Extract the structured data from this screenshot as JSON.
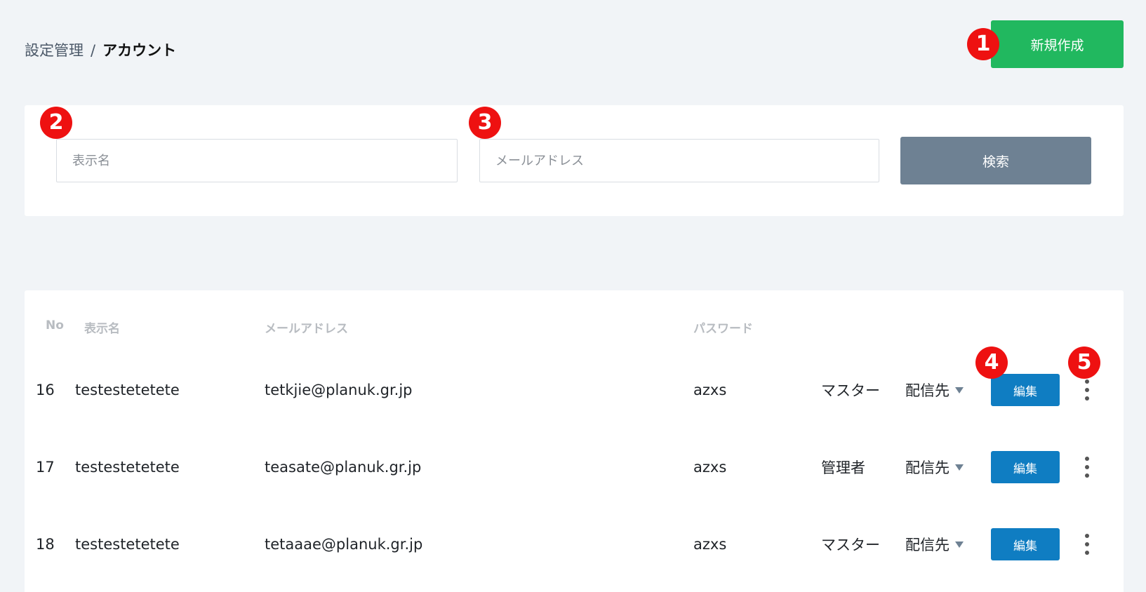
{
  "breadcrumb": {
    "parent": "設定管理",
    "separator": "/",
    "current": "アカウント"
  },
  "header": {
    "new_button": "新規作成"
  },
  "markers": [
    "1",
    "2",
    "3",
    "4",
    "5"
  ],
  "search": {
    "name_placeholder": "表示名",
    "email_placeholder": "メールアドレス",
    "search_button": "検索"
  },
  "table": {
    "headers": {
      "no": "No",
      "name": "表示名",
      "email": "メールアドレス",
      "password": "パスワード"
    },
    "rows": [
      {
        "no": "16",
        "name": "testestetetete",
        "email": "tetkjie@planuk.gr.jp",
        "password": "azxs",
        "role": "マスター",
        "dest": "配信先",
        "edit": "編集"
      },
      {
        "no": "17",
        "name": "testestetetete",
        "email": "teasate@planuk.gr.jp",
        "password": "azxs",
        "role": "管理者",
        "dest": "配信先",
        "edit": "編集"
      },
      {
        "no": "18",
        "name": "testestetetete",
        "email": "tetaaae@planuk.gr.jp",
        "password": "azxs",
        "role": "マスター",
        "dest": "配信先",
        "edit": "編集"
      }
    ]
  },
  "colors": {
    "primary_green": "#21b85f",
    "edit_blue": "#0f7dc2",
    "search_gray": "#6e8193",
    "marker_red": "#ee1111"
  }
}
